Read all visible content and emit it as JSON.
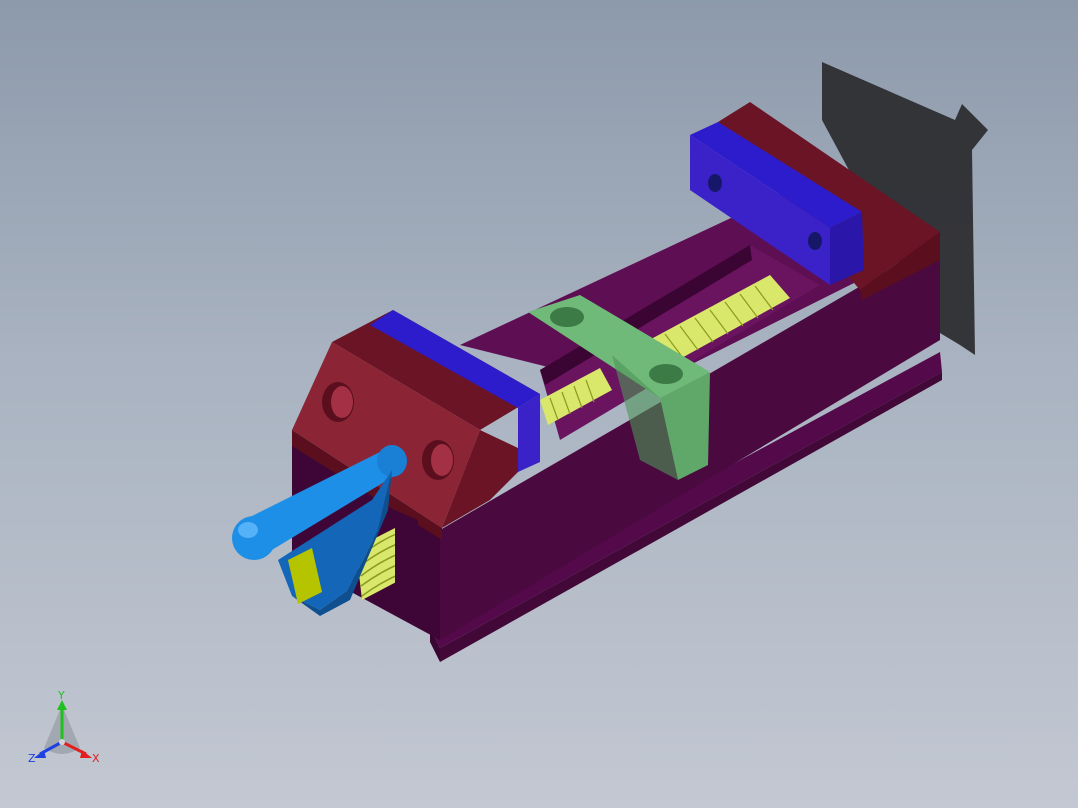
{
  "viewport": {
    "background_top": "#8d9aab",
    "background_bottom": "#c3c8d2"
  },
  "model": {
    "name": "machine-vise",
    "colors": {
      "base_top": "#5e0e52",
      "base_side": "#4a0a40",
      "base_front": "#3a0532",
      "jaw_body": "#8b2535",
      "jaw_side": "#6a1425",
      "jaw_dark": "#5a0e1e",
      "jaw_plate_top": "#2d1ccc",
      "jaw_plate_front": "#3b22c8",
      "screw": "#d9e86a",
      "clamp_plate": "#5fa86a",
      "handle": "#1e8fe6",
      "handle_dark": "#1466b8",
      "handle_square": "#b6c400",
      "shadow": "#2a2a2e"
    }
  },
  "triad": {
    "x_label": "X",
    "y_label": "Y",
    "z_label": "Z",
    "x_color": "#e02020",
    "y_color": "#20c020",
    "z_color": "#2040e0"
  }
}
